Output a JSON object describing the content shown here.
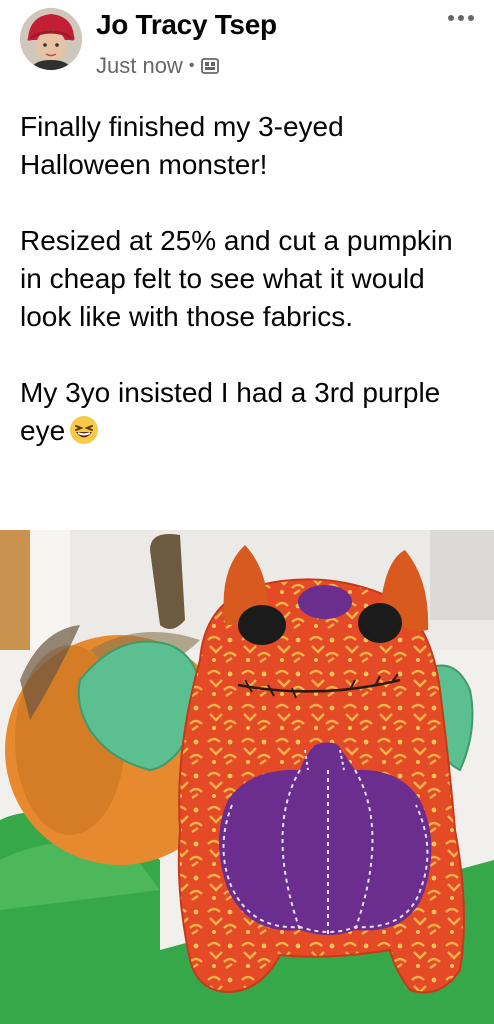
{
  "post": {
    "author": "Jo Tracy Tsep",
    "timestamp": "Just now",
    "separator": "•",
    "audience_icon": "album-privacy-icon",
    "more_icon": "more-options-icon",
    "text": {
      "p1": "Finally finished my 3-eyed Halloween monster!",
      "p2": "Resized at 25% and cut a pumpkin in cheap felt to see what it would look like with those fabrics.",
      "p3": "My 3yo insisted I had a 3rd purple eye"
    },
    "emoji": "laughing-face-emoji"
  },
  "colors": {
    "name": "#050505",
    "meta": "#65676b",
    "monster": "#e34a25",
    "felt_purple": "#6b2e8f",
    "felt_green": "#5cbf8f",
    "pumpkin": "#e7892e"
  }
}
